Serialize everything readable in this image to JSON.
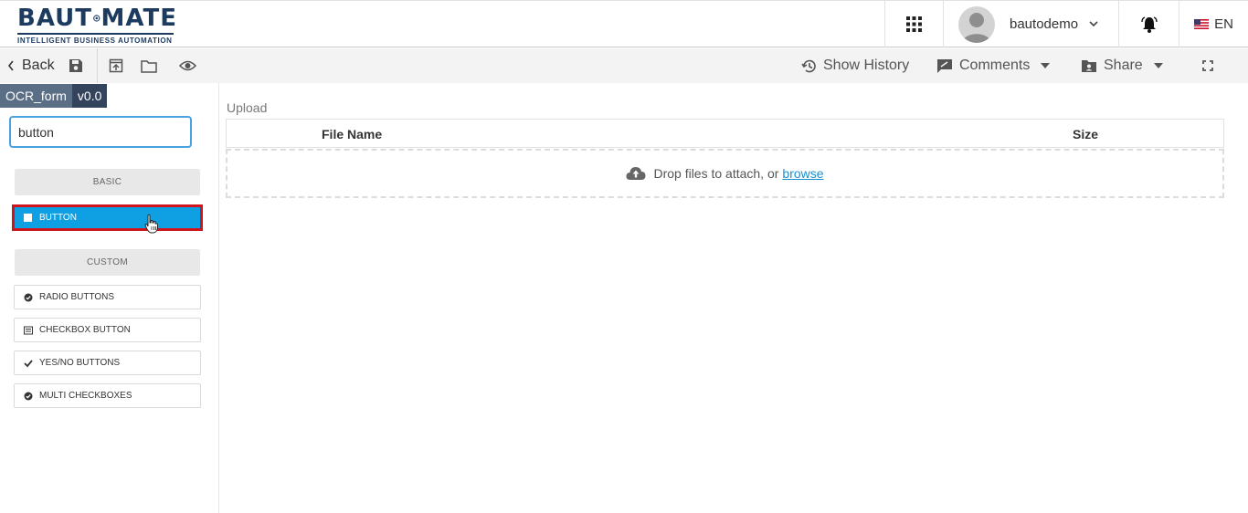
{
  "header": {
    "logo_text_left": "BAUT",
    "logo_text_right": "MATE",
    "logo_tagline": "INTELLIGENT BUSINESS AUTOMATION",
    "apps_icon": "grid-icon",
    "username": "bautodemo",
    "notification_icon": "bell-icon",
    "language": "EN",
    "language_flag": "us-flag-icon"
  },
  "toolbar": {
    "back_label": "Back",
    "show_history_label": "Show History",
    "comments_label": "Comments",
    "share_label": "Share",
    "icons": [
      "save-icon",
      "export-icon",
      "folder-icon",
      "eye-icon",
      "history-icon",
      "comment-icon",
      "share-folder-icon",
      "fullscreen-icon"
    ]
  },
  "sidebar": {
    "form_name": "OCR_form",
    "form_version": "v0.0",
    "search_value": "button",
    "groups": {
      "basic": "BASIC",
      "custom": "CUSTOM"
    },
    "basic_items": [
      {
        "label": "BUTTON",
        "icon": "square-icon",
        "selected": true
      }
    ],
    "custom_items": [
      {
        "label": "RADIO BUTTONS",
        "icon": "check-circle-icon"
      },
      {
        "label": "CHECKBOX BUTTON",
        "icon": "list-icon"
      },
      {
        "label": "YES/NO BUTTONS",
        "icon": "check-icon"
      },
      {
        "label": "MULTI CHECKBOXES",
        "icon": "check-circle-icon"
      }
    ]
  },
  "main": {
    "component_label": "Upload",
    "columns": [
      "File Name",
      "Size"
    ],
    "dropzone_text": "Drop files to attach, or",
    "dropzone_link": "browse"
  },
  "colors": {
    "brand": "#1d3a5f",
    "accent": "#0fa0e3",
    "highlight_border": "#d0141c",
    "link": "#1a8fd0"
  }
}
